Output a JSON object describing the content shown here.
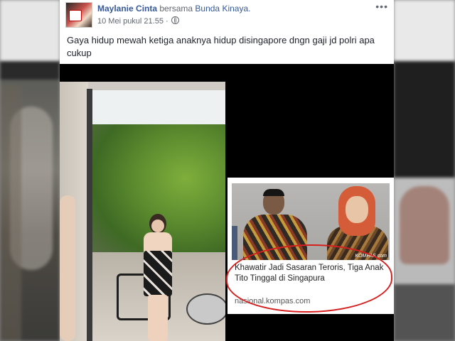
{
  "post": {
    "author": "Maylanie Cinta",
    "with_text": "bersama",
    "tagged": "Bunda Kinaya.",
    "timestamp": "10 Mei pukul 21.55 ·",
    "privacy_icon": "globe-icon",
    "more_label": "•••",
    "body_text": "Gaya hidup mewah ketiga anaknya hidup disingapore dngn gaji jd polri apa cukup"
  },
  "news_card": {
    "headline": "Khawatir Jadi Sasaran Teroris, Tiga Anak Tito Tinggal di Singapura",
    "source": "nasional.kompas.com",
    "logo": "KOMPAS.com"
  },
  "colors": {
    "link_blue": "#365899",
    "meta_gray": "#606770",
    "highlight_red": "#d61f1f"
  }
}
